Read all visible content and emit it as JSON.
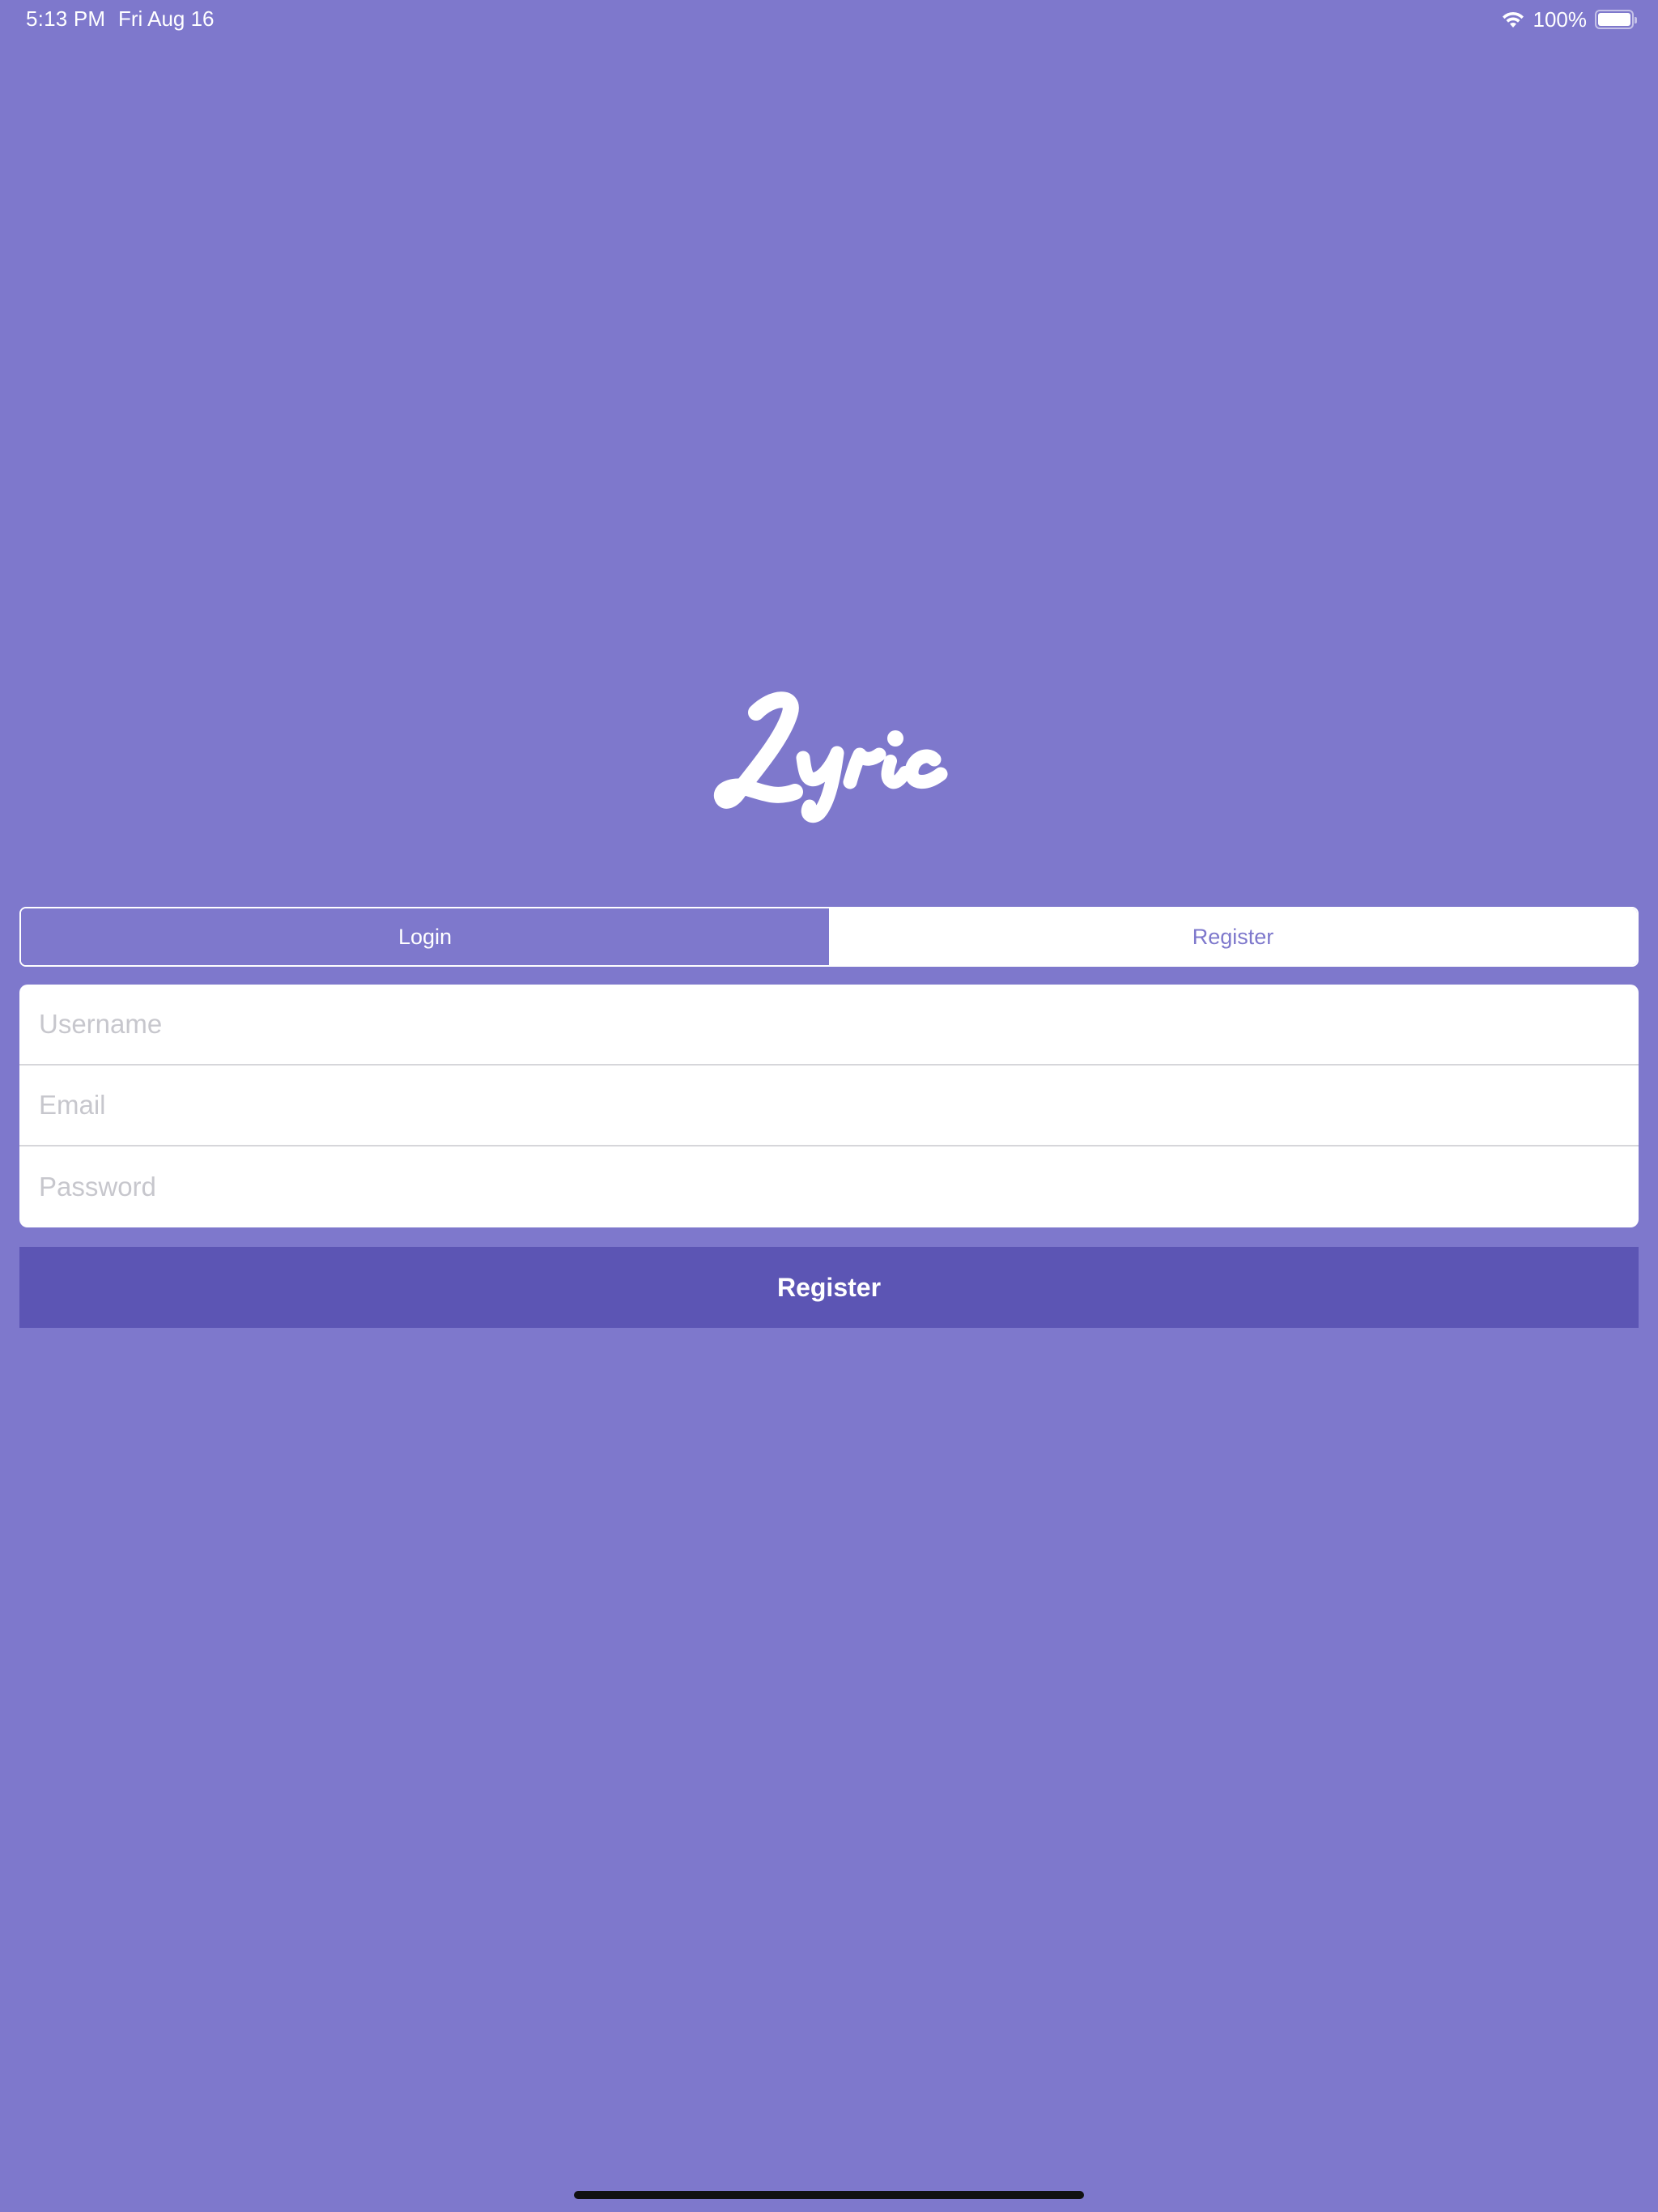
{
  "status_bar": {
    "time": "5:13 PM",
    "date": "Fri Aug 16",
    "battery_percent": "100%",
    "battery_level": 1.0,
    "icons": [
      "wifi-icon",
      "battery-icon"
    ]
  },
  "logo": {
    "text": "Lyric"
  },
  "segmented_control": {
    "selected": "Register",
    "segments": [
      {
        "label": "Login"
      },
      {
        "label": "Register"
      }
    ]
  },
  "form": {
    "username": {
      "placeholder": "Username",
      "value": ""
    },
    "email": {
      "placeholder": "Email",
      "value": ""
    },
    "password": {
      "placeholder": "Password",
      "value": ""
    }
  },
  "actions": {
    "register_label": "Register"
  },
  "colors": {
    "background": "#7e78cc",
    "button": "#5c55b4",
    "white": "#ffffff",
    "placeholder": "#c7c7cd"
  }
}
